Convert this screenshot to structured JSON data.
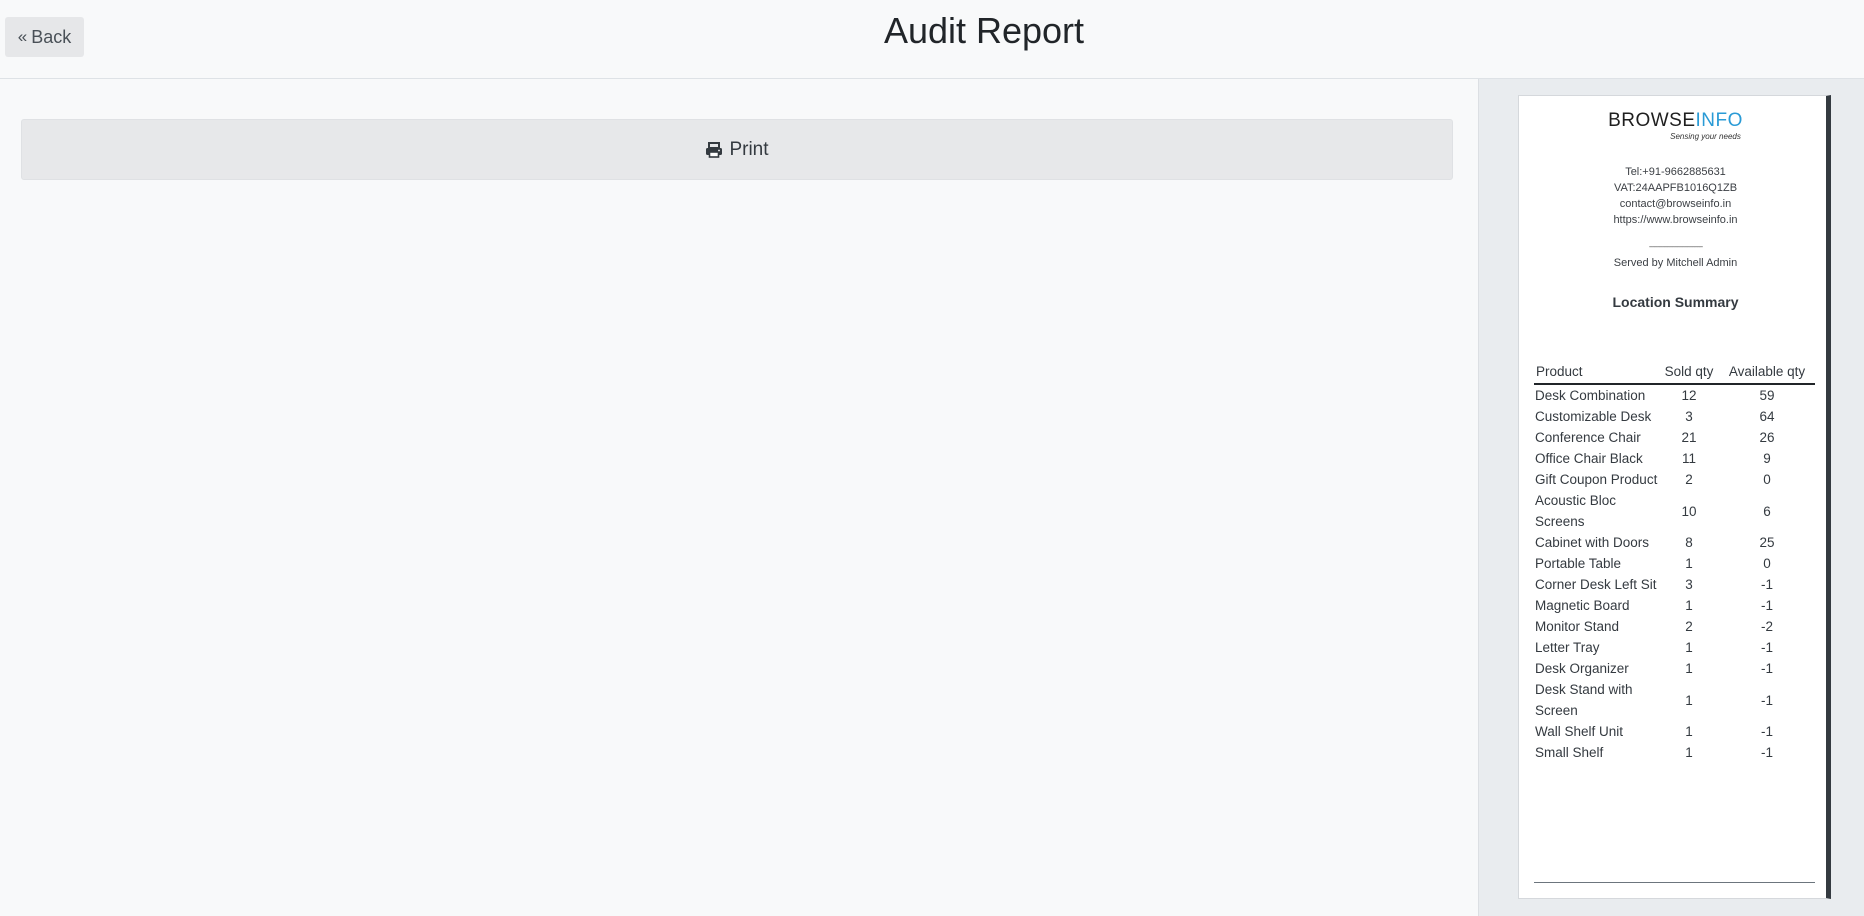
{
  "header": {
    "back_label": "Back",
    "title": "Audit Report"
  },
  "toolbar": {
    "print_label": "Print"
  },
  "receipt": {
    "logo": {
      "part1": "BROWSE",
      "part2": "INFO",
      "tagline": "Sensing your needs"
    },
    "contact": {
      "tel": "Tel:+91-9662885631",
      "vat": "VAT:24AAPFB1016Q1ZB",
      "email": "contact@browseinfo.in",
      "website": "https://www.browseinfo.in"
    },
    "separator": "--------------------------------",
    "served_by": "Served by Mitchell Admin",
    "summary_title": "Location Summary",
    "table": {
      "headers": [
        "Product",
        "Sold qty",
        "Available qty"
      ],
      "rows": [
        {
          "product": "Desk Combination",
          "sold": "12",
          "available": "59"
        },
        {
          "product": "Customizable Desk",
          "sold": "3",
          "available": "64"
        },
        {
          "product": "Conference Chair",
          "sold": "21",
          "available": "26"
        },
        {
          "product": "Office Chair Black",
          "sold": "11",
          "available": "9"
        },
        {
          "product": "Gift Coupon Product",
          "sold": "2",
          "available": "0"
        },
        {
          "product": "Acoustic Bloc Screens",
          "sold": "10",
          "available": "6"
        },
        {
          "product": "Cabinet with Doors",
          "sold": "8",
          "available": "25"
        },
        {
          "product": "Portable Table",
          "sold": "1",
          "available": "0"
        },
        {
          "product": "Corner Desk Left Sit",
          "sold": "3",
          "available": "-1"
        },
        {
          "product": "Magnetic Board",
          "sold": "1",
          "available": "-1"
        },
        {
          "product": "Monitor Stand",
          "sold": "2",
          "available": "-2"
        },
        {
          "product": "Letter Tray",
          "sold": "1",
          "available": "-1"
        },
        {
          "product": "Desk Organizer",
          "sold": "1",
          "available": "-1"
        },
        {
          "product": "Desk Stand with Screen",
          "sold": "1",
          "available": "-1"
        },
        {
          "product": "Wall Shelf Unit",
          "sold": "1",
          "available": "-1"
        },
        {
          "product": "Small Shelf",
          "sold": "1",
          "available": "-1"
        }
      ]
    }
  }
}
